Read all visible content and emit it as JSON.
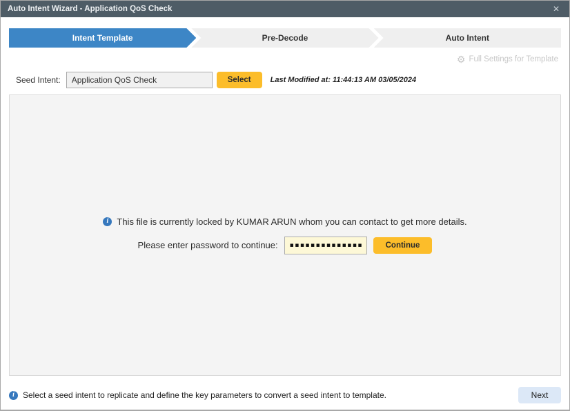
{
  "window": {
    "title": "Auto Intent Wizard - Application QoS Check"
  },
  "icons": {
    "close_glyph": "✕",
    "gear_glyph": "⚙",
    "info_glyph": "i"
  },
  "wizard": {
    "steps": [
      {
        "label": "Intent Template",
        "active": true
      },
      {
        "label": "Pre-Decode",
        "active": false
      },
      {
        "label": "Auto Intent",
        "active": false
      }
    ]
  },
  "header": {
    "full_settings_label": "Full Settings for Template",
    "seed_intent_label": "Seed Intent:",
    "seed_intent_value": "Application QoS Check",
    "select_button": "Select",
    "last_modified": "Last Modified at: 11:44:13 AM 03/05/2024"
  },
  "lock_panel": {
    "message": "This file is currently locked by KUMAR ARUN whom you can contact to get more details.",
    "password_label": "Please enter password to continue:",
    "password_masked": "▪▪▪▪▪▪▪▪▪▪▪▪▪▪▪",
    "continue_button": "Continue"
  },
  "footer": {
    "hint": "Select a seed intent to replicate and define the key parameters to convert a seed intent to template.",
    "next_button": "Next"
  },
  "colors": {
    "titlebar": "#4e5c66",
    "active_step_blue": "#3d86c6",
    "action_orange": "#fcbd2a",
    "info_blue": "#3678bd",
    "password_field_yellow": "#fdf8d7",
    "next_button_blue": "#dce8f7"
  }
}
